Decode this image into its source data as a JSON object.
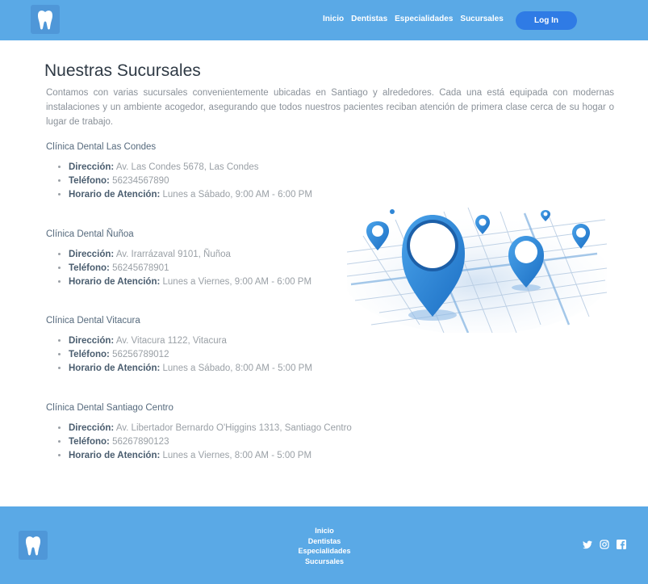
{
  "header": {
    "nav": [
      "Inicio",
      "Dentistas",
      "Especialidades",
      "Sucursales"
    ],
    "login_label": "Log In"
  },
  "main": {
    "title": "Nuestras Sucursales",
    "intro": "Contamos con varias sucursales convenientemente ubicadas en Santiago y alrededores. Cada una está equipada con modernas instalaciones y un ambiente acogedor, asegurando que todos nuestros pacientes reciban atención de primera clase cerca de su hogar o lugar de trabajo.",
    "labels": {
      "address": "Dirección:",
      "phone": "Teléfono:",
      "hours": "Horario de Atención:"
    },
    "branches": [
      {
        "name": "Clínica Dental Las Condes",
        "address": "Av. Las Condes 5678, Las Condes",
        "phone": "56234567890",
        "hours": "Lunes a Sábado, 9:00 AM - 6:00 PM"
      },
      {
        "name": "Clínica Dental Ñuñoa",
        "address": "Av. Irarrázaval 9101, Ñuñoa",
        "phone": "56245678901",
        "hours": "Lunes a Viernes, 9:00 AM - 6:00 PM"
      },
      {
        "name": "Clínica Dental Vitacura",
        "address": "Av. Vitacura 1122, Vitacura",
        "phone": "56256789012",
        "hours": "Lunes a Sábado, 8:00 AM - 5:00 PM"
      },
      {
        "name": "Clínica Dental Santiago Centro",
        "address": "Av. Libertador Bernardo O'Higgins 1313, Santiago Centro",
        "phone": "56267890123",
        "hours": "Lunes a Viernes, 8:00 AM - 5:00 PM"
      }
    ],
    "illustration_icon": "map-pins-illustration"
  },
  "footer": {
    "nav": [
      "Inicio",
      "Dentistas",
      "Especialidades",
      "Sucursales"
    ],
    "social_icons": [
      "twitter-icon",
      "instagram-icon",
      "facebook-icon"
    ]
  },
  "colors": {
    "header_bg": "#5aa9e6",
    "login_bg": "#2f7be5",
    "text_muted": "#8a9199",
    "pin_blue": "#2f86d6"
  }
}
